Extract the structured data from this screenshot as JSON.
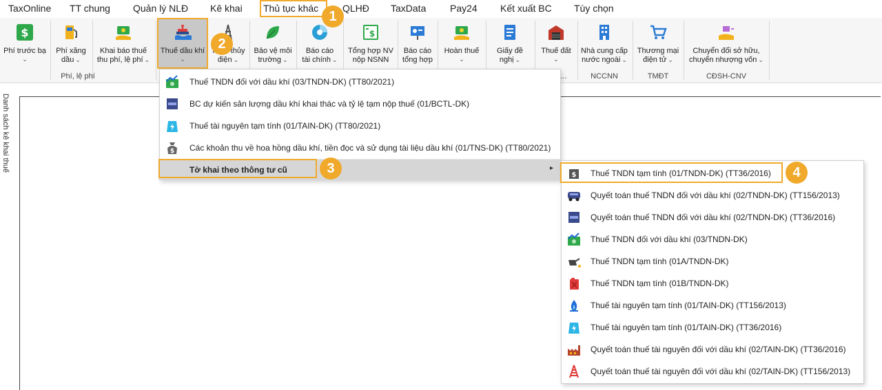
{
  "tabs": [
    {
      "label": "TaxOnline"
    },
    {
      "label": "TT chung"
    },
    {
      "label": "Quản lý NLĐ"
    },
    {
      "label": "Kê khai"
    },
    {
      "label": "Thủ tục khác"
    },
    {
      "label": "QLHĐ"
    },
    {
      "label": "TaxData"
    },
    {
      "label": "Pay24"
    },
    {
      "label": "Kết xuất BC"
    },
    {
      "label": "Tùy chọn"
    }
  ],
  "ribbon": {
    "buttons": [
      {
        "line1": "Phí trước bạ",
        "line2": ""
      },
      {
        "line1": "Phí xăng",
        "line2": "dầu"
      },
      {
        "line1": "Khai báo thuế",
        "line2": "thu phí, lệ phí"
      },
      {
        "line1": "Thuế dầu khí",
        "line2": ""
      },
      {
        "line1": "Thuế thủy",
        "line2": "điện"
      },
      {
        "line1": "Bảo vệ môi",
        "line2": "trường"
      },
      {
        "line1": "Báo cáo",
        "line2": "tài chính"
      },
      {
        "line1": "Tổng hợp NV",
        "line2": "nộp NSNN"
      },
      {
        "line1": "Báo cáo",
        "line2": "tổng hợp"
      },
      {
        "line1": "Hoàn thuế",
        "line2": ""
      },
      {
        "line1": "Giấy đề",
        "line2": "nghị"
      },
      {
        "line1": "Thuế đất",
        "line2": ""
      },
      {
        "line1": "Nhà cung cấp",
        "line2": "nước ngoài"
      },
      {
        "line1": "Thương mại",
        "line2": "điện tử"
      },
      {
        "line1": "Chuyển đổi sở hữu,",
        "line2": "chuyển nhượng vốn"
      }
    ],
    "groups": [
      "Phí, lệ phí",
      "...",
      "NCCNN",
      "TMĐT",
      "CĐSH-CNV"
    ]
  },
  "side_panel": {
    "label": "Danh sách kê khai thuế"
  },
  "menu1": {
    "items": [
      {
        "label": "Thuế TNDN đối với dầu khí (03/TNDN-DK) (TT80/2021)",
        "icon": "chart-up-icon"
      },
      {
        "label": "BC dự kiến sản lượng dầu khí  khai thác và tỷ lệ tạm nộp thuế (01/BCTL-DK)",
        "icon": "report-icon"
      },
      {
        "label": "Thuế tài nguyên tạm tính (01/TAIN-DK) (TT80/2021)",
        "icon": "energy-icon"
      },
      {
        "label": "Các khoản thu về hoa hồng dầu khí, tiền đọc và sử dụng tài liệu dầu khí (01/TNS-DK) (TT80/2021)",
        "icon": "money-bag-icon"
      }
    ],
    "submenu_label": "Tờ khai theo thông tư cũ"
  },
  "menu2": {
    "items": [
      {
        "label": "Thuế TNDN tạm tính (01/TNDN-DK) (TT36/2016)",
        "icon": "money-bag-icon"
      },
      {
        "label": "Quyết toán thuế TNDN đối với dầu khí (02/TNDN-DK) (TT156/2013)",
        "icon": "truck-icon"
      },
      {
        "label": "Quyết toán thuế TNDN đối với dầu khí (02/TNDN-DK) (TT36/2016)",
        "icon": "report-icon"
      },
      {
        "label": "Thuế TNDN đối với dầu khí (03/TNDN-DK)",
        "icon": "chart-up-icon"
      },
      {
        "label": "Thuế TNDN tạm tính (01A/TNDN-DK)",
        "icon": "oil-can-icon"
      },
      {
        "label": "Thuế TNDN tạm tính (01B/TNDN-DK)",
        "icon": "jerrycan-icon"
      },
      {
        "label": "Thuế tài nguyên tạm tính (01/TAIN-DK) (TT156/2013)",
        "icon": "gas-flame-icon"
      },
      {
        "label": "Thuế tài nguyên tạm tính (01/TAIN-DK) (TT36/2016)",
        "icon": "energy-icon"
      },
      {
        "label": "Quyết toán thuế tài nguyên đối với dầu khí (02/TAIN-DK) (TT36/2016)",
        "icon": "factory-icon"
      },
      {
        "label": "Quyết toán thuế tài nguyên đối với dầu khí (02/TAIN-DK) (TT156/2013)",
        "icon": "oil-rig-icon"
      }
    ]
  },
  "steps": [
    "1",
    "2",
    "3",
    "4"
  ],
  "colors": {
    "accent": "#f0a92a",
    "selected": "#c8c8c8",
    "green": "#2ea84a"
  }
}
